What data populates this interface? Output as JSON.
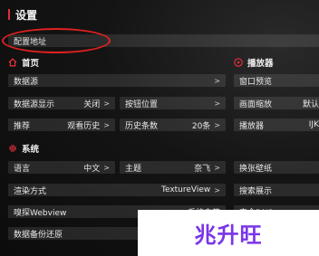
{
  "page": {
    "title": "设置"
  },
  "address_row": {
    "label": "配置地址"
  },
  "sections": {
    "home": {
      "title": "首页",
      "icon": "home-icon"
    },
    "player": {
      "title": "播放器",
      "icon": "play-circle-icon"
    },
    "system": {
      "title": "系统",
      "icon": "gear-icon"
    }
  },
  "rows": {
    "datasource": {
      "label": "数据源",
      "chev": ">"
    },
    "datasource_display": {
      "label": "数据源显示",
      "value": "关闭",
      "chev": ">"
    },
    "button_position": {
      "label": "按钮位置",
      "chev": ">"
    },
    "recommend": {
      "label": "推荐",
      "value": "观看历史",
      "chev": ">"
    },
    "history_count": {
      "label": "历史条数",
      "value": "20条",
      "chev": ">"
    },
    "window_preview": {
      "label": "窗口预览"
    },
    "screen_scale": {
      "label": "画面缩放",
      "value": "默认"
    },
    "player_engine": {
      "label": "播放器",
      "value": "IJK"
    },
    "language": {
      "label": "语言",
      "value": "中文",
      "chev": ">"
    },
    "theme": {
      "label": "主题",
      "value": "奈飞",
      "chev": ">"
    },
    "wallpaper": {
      "label": "换张壁纸"
    },
    "render_mode": {
      "label": "渲染方式",
      "value": "TextureView",
      "chev": ">"
    },
    "search_display": {
      "label": "搜索展示"
    },
    "sniff_webview": {
      "label": "嗅探Webview",
      "value": "系统自带"
    },
    "secure_dns": {
      "label": "安全DNS"
    },
    "backup_restore": {
      "label": "数据备份还原"
    }
  },
  "watermark": {
    "text": "兆升旺"
  },
  "colors": {
    "accent": "#e0303a",
    "annotation": "#e02020",
    "watermark": "#7a35e8"
  }
}
